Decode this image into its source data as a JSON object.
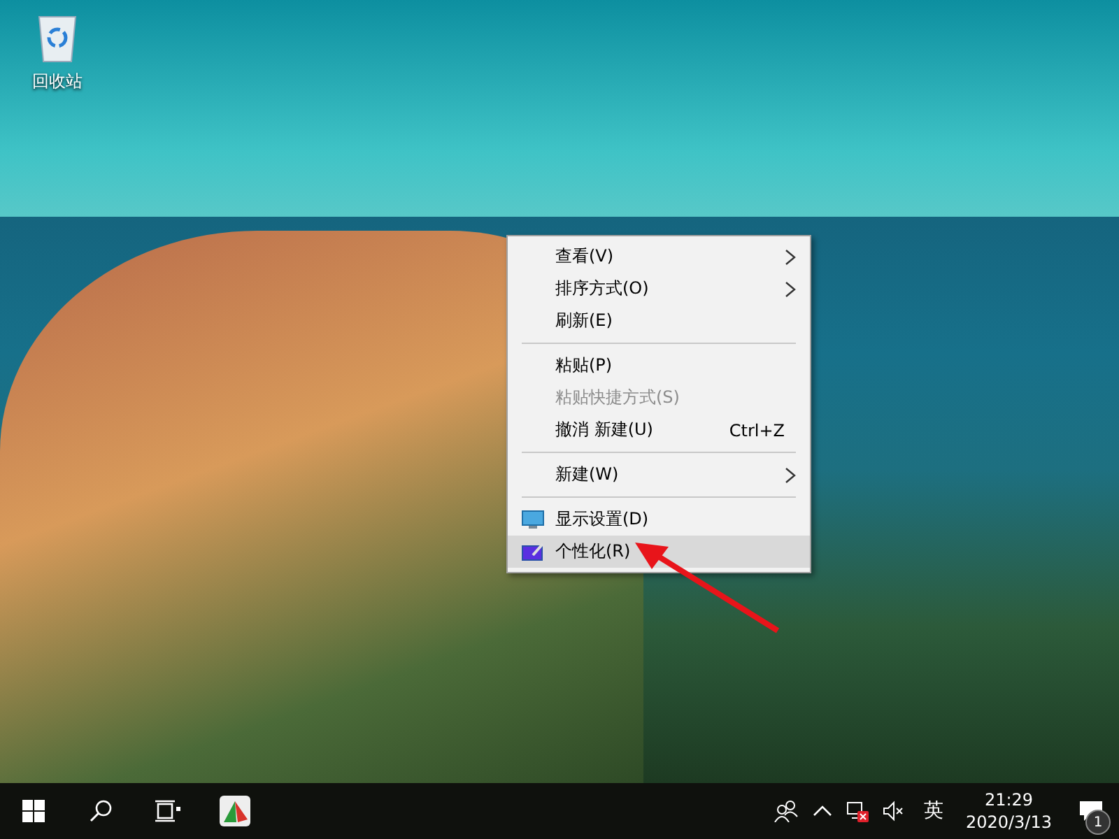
{
  "desktop": {
    "icons": [
      {
        "label": "回收站"
      }
    ]
  },
  "context_menu": {
    "items": [
      {
        "kind": "command",
        "label": "查看(V)",
        "submenu": true,
        "disabled": false,
        "selected": false
      },
      {
        "kind": "command",
        "label": "排序方式(O)",
        "submenu": true,
        "disabled": false,
        "selected": false
      },
      {
        "kind": "command",
        "label": "刷新(E)",
        "submenu": false,
        "disabled": false,
        "selected": false
      },
      {
        "kind": "separator"
      },
      {
        "kind": "command",
        "label": "粘贴(P)",
        "submenu": false,
        "disabled": false,
        "selected": false
      },
      {
        "kind": "command",
        "label": "粘贴快捷方式(S)",
        "submenu": false,
        "disabled": true,
        "selected": false
      },
      {
        "kind": "command",
        "label": "撤消 新建(U)",
        "shortcut": "Ctrl+Z",
        "submenu": false,
        "disabled": false,
        "selected": false
      },
      {
        "kind": "separator"
      },
      {
        "kind": "command",
        "label": "新建(W)",
        "submenu": true,
        "disabled": false,
        "selected": false
      },
      {
        "kind": "separator"
      },
      {
        "kind": "display",
        "label": "显示设置(D)",
        "submenu": false,
        "disabled": false,
        "selected": false
      },
      {
        "kind": "personalize",
        "label": "个性化(R)",
        "submenu": false,
        "disabled": false,
        "selected": true
      }
    ]
  },
  "taskbar": {
    "input_language": "英",
    "clock": {
      "time": "21:29",
      "date": "2020/3/13"
    },
    "notifications": {
      "count": "1"
    }
  }
}
